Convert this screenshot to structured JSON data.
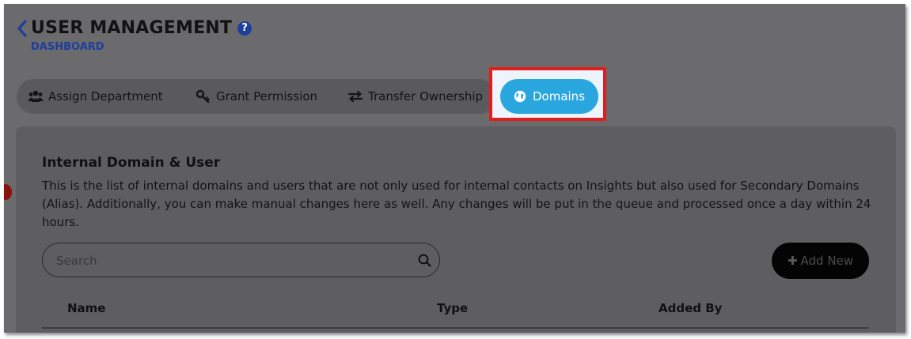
{
  "header": {
    "title": "USER MANAGEMENT",
    "help_icon_glyph": "?",
    "breadcrumb": "DASHBOARD"
  },
  "tabs": [
    {
      "label": "Assign Department",
      "icon": "users-icon"
    },
    {
      "label": "Grant Permission",
      "icon": "key-icon"
    },
    {
      "label": "Transfer Ownership",
      "icon": "transfer-icon"
    },
    {
      "label": "Domains",
      "icon": "globe-icon",
      "active": true
    }
  ],
  "section": {
    "title": "Internal Domain & User",
    "description": "This is the list of internal domains and users that are not only used for internal contacts on Insights but also used for Secondary Domains (Alias). Additionally, you can make manual changes here as well. Any changes will be put in the queue and processed once a day within 24 hours."
  },
  "search": {
    "placeholder": "Search",
    "value": ""
  },
  "add_button": {
    "label": "Add New",
    "icon": "plus-icon"
  },
  "table": {
    "columns": [
      "Name",
      "Type",
      "Added By"
    ],
    "rows": []
  },
  "colors": {
    "overlay": "#6b6b6e",
    "active_tab": "#2aa6df",
    "highlight_border": "#e01e1e",
    "accent_blue": "#1c3f9c"
  }
}
